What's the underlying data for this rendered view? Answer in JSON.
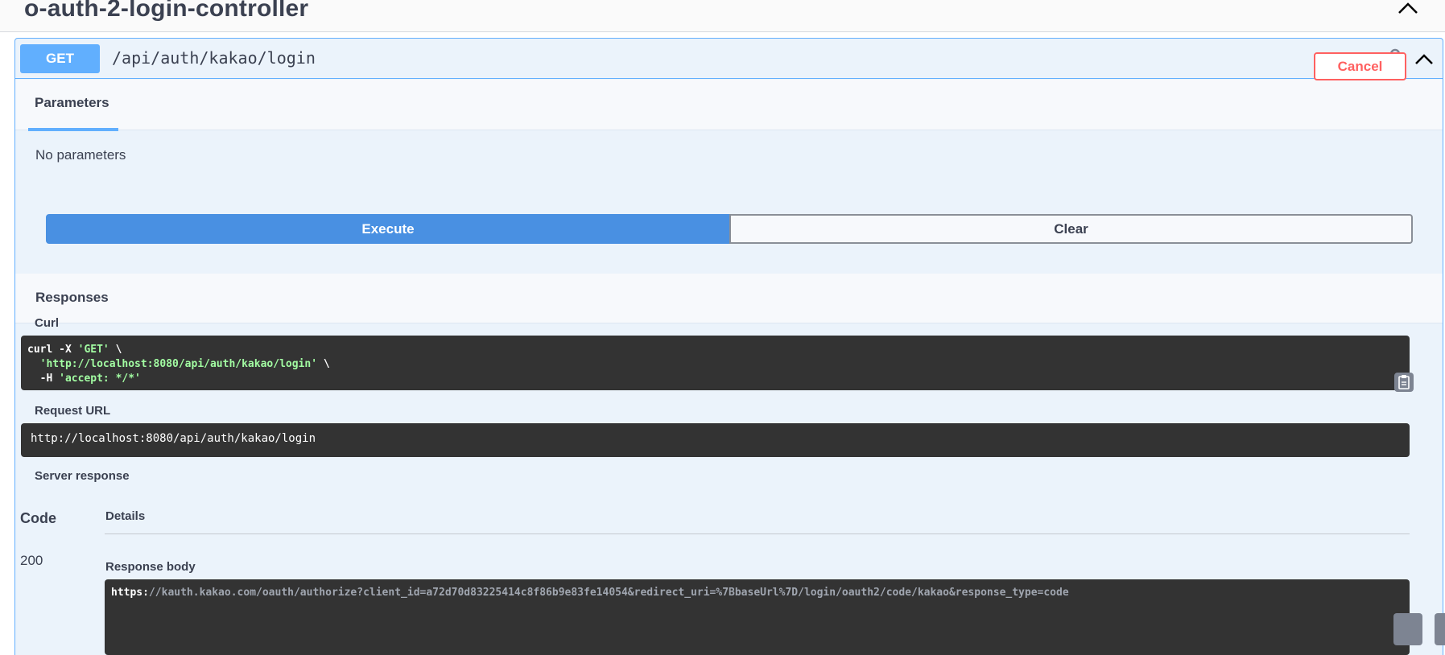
{
  "tag": {
    "title": "o-auth-2-login-controller"
  },
  "operation": {
    "method": "GET",
    "path": "/api/auth/kakao/login"
  },
  "parameters": {
    "tab_label": "Parameters",
    "cancel_label": "Cancel",
    "empty_text": "No parameters"
  },
  "actions": {
    "execute_label": "Execute",
    "clear_label": "Clear"
  },
  "responses": {
    "title": "Responses",
    "curl_label": "Curl",
    "curl_line1_cmd": "curl -X ",
    "curl_line1_method": "'GET'",
    "curl_line1_tail": " \\",
    "curl_line2_url": "'http://localhost:8080/api/auth/kakao/login'",
    "curl_line2_tail": " \\",
    "curl_line3_flag": "-H ",
    "curl_line3_header": "'accept: */*'",
    "request_url_label": "Request URL",
    "request_url": "http://localhost:8080/api/auth/kakao/login",
    "server_response_label": "Server response",
    "col_code": "Code",
    "col_details": "Details",
    "status_code": "200",
    "response_body_label": "Response body",
    "response_body_scheme": "https:",
    "response_body_rest": "//kauth.kakao.com/oauth/authorize?client_id=a72d70d83225414c8f86b9e83fe14054&redirect_uri=%7BbaseUrl%7D/login/oauth2/code/kakao&response_type=code"
  },
  "colors": {
    "get_method": "#61affe",
    "cancel": "#ff6060",
    "execute": "#4990e2",
    "code_background": "#333333",
    "curl_string": "#a2fca2"
  }
}
